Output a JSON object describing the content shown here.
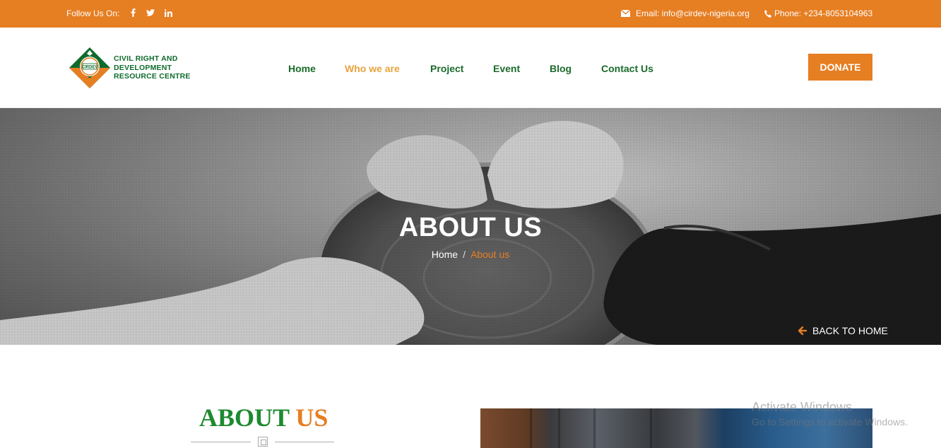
{
  "topbar": {
    "follow_label": "Follow Us On:",
    "social_icons": [
      "facebook-icon",
      "twitter-icon",
      "linkedin-icon"
    ],
    "email_text": "Email: info@cirdev-nigeria.org",
    "phone_text": "Phone: +234-8053104963",
    "background_color": "#e67e22"
  },
  "header": {
    "logo_badge": "CIRDEV",
    "logo_lines": [
      "CIVIL RIGHT AND",
      "DEVELOPMENT",
      "RESOURCE CENTRE"
    ],
    "nav": [
      {
        "label": "Home",
        "active": false
      },
      {
        "label": "Who we are",
        "active": true
      },
      {
        "label": "Project",
        "active": false
      },
      {
        "label": "Event",
        "active": false
      },
      {
        "label": "Blog",
        "active": false
      },
      {
        "label": "Contact Us",
        "active": false
      }
    ],
    "donate_label": "DONATE"
  },
  "hero": {
    "title": "ABOUT US",
    "breadcrumb_home": "Home",
    "breadcrumb_separator": "/",
    "breadcrumb_current": "About us",
    "back_home_label": "BACK TO HOME"
  },
  "content": {
    "heading_part1": "ABOUT",
    "heading_part2": "US"
  },
  "watermark": {
    "title": "Activate Windows",
    "subtitle": "Go to Settings to activate Windows."
  },
  "colors": {
    "accent_orange": "#e67e22",
    "nav_green": "#1a6b2a",
    "nav_active": "#e8a33d",
    "heading_green": "#1d8a2f"
  }
}
